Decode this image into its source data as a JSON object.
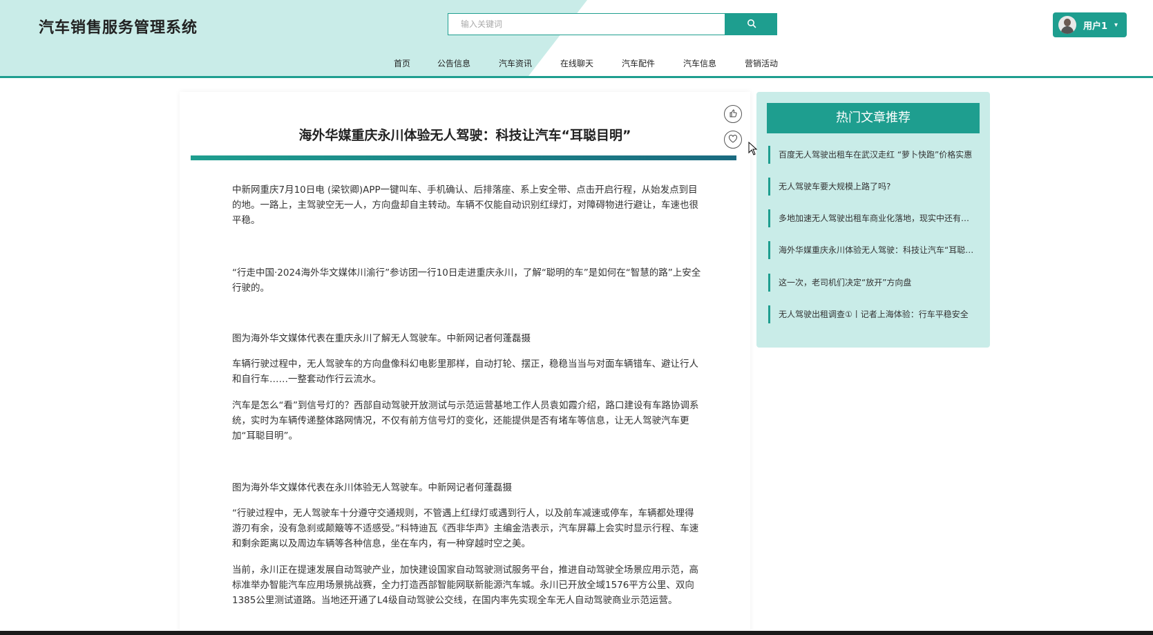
{
  "header": {
    "app_title": "汽车销售服务管理系统",
    "search_placeholder": "输入关键词",
    "user_label": "用户1",
    "nav": [
      "首页",
      "公告信息",
      "汽车资讯",
      "在线聊天",
      "汽车配件",
      "汽车信息",
      "营销活动"
    ]
  },
  "article": {
    "title": "海外华媒重庆永川体验无人驾驶：科技让汽车“耳聪目明”",
    "paragraphs": [
      "中新网重庆7月10日电 (梁钦卿)APP一键叫车、手机确认、后排落座、系上安全带、点击开启行程，从始发点到目的地。一路上，主驾驶空无一人，方向盘却自主转动。车辆不仅能自动识别红绿灯，对障碍物进行避让，车速也很平稳。",
      "“行走中国·2024海外华文媒体川渝行”参访团一行10日走进重庆永川，了解“聪明的车”是如何在“智慧的路”上安全行驶的。",
      "图为海外华文媒体代表在重庆永川了解无人驾驶车。中新网记者何蓬磊摄",
      "车辆行驶过程中，无人驾驶车的方向盘像科幻电影里那样，自动打轮、摆正，稳稳当当与对面车辆错车、避让行人和自行车……一整套动作行云流水。",
      "汽车是怎么“看”到信号灯的？西部自动驾驶开放测试与示范运营基地工作人员袁如霞介绍，路口建设有车路协调系统，实时为车辆传递整体路网情况，不仅有前方信号灯的变化，还能提供是否有堵车等信息，让无人驾驶汽车更加“耳聪目明”。",
      "图为海外华文媒体代表在永川体验无人驾驶车。中新网记者何蓬磊摄",
      "“行驶过程中，无人驾驶车十分遵守交通规则，不管遇上红绿灯或遇到行人，以及前车减速或停车，车辆都处理得游刃有余，没有急刹或颠簸等不适感受。”科特迪瓦《西非华声》主编金浩表示，汽车屏幕上会实时显示行程、车速和剩余距离以及周边车辆等各种信息，坐在车内，有一种穿越时空之美。",
      "当前，永川正在提速发展自动驾驶产业，加快建设国家自动驾驶测试服务平台，推进自动驾驶全场景应用示范，高标准举办智能汽车应用场景挑战赛，全力打造西部智能网联新能源汽车城。永川已开放全域1576平方公里、双向1385公里测试道路。当地还开通了L4级自动驾驶公交线，在国内率先实现全车无人自动驾驶商业示范运营。"
    ]
  },
  "sidebar": {
    "heading": "热门文章推荐",
    "items": [
      "百度无人驾驶出租车在武汉走红 “萝卜快跑”价格实惠",
      "无人驾驶车要大规模上路了吗?",
      "多地加速无人驾驶出租车商业化落地，现实中还有哪些挑战",
      "海外华媒重庆永川体验无人驾驶：科技让汽车“耳聪目明”",
      "这一次，老司机们决定“放开”方向盘",
      "无人驾驶出租调查①丨记者上海体验：行车平稳安全"
    ]
  },
  "colors": {
    "accent": "#1e9e8f",
    "header_tint": "#c9ece8",
    "sidebar_bg": "#c9ece8"
  },
  "icons": [
    "search-icon",
    "thumbs-up-icon",
    "heart-icon",
    "chevron-down-icon",
    "mouse-cursor-icon"
  ]
}
